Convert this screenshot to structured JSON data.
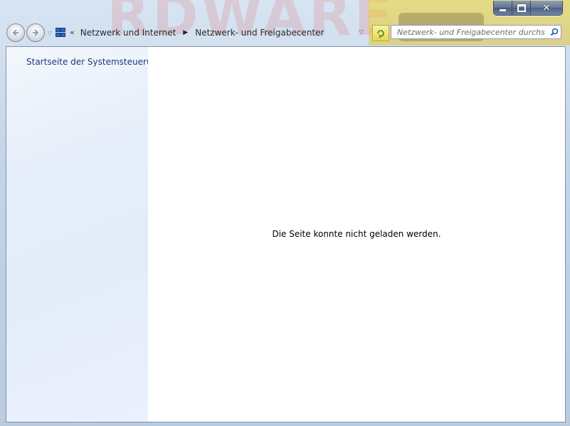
{
  "window": {
    "caption_buttons": {
      "minimize_icon": "minimize-icon",
      "maximize_icon": "maximize-icon",
      "close_glyph": "✕"
    }
  },
  "navigation": {
    "back_icon": "back-arrow-icon",
    "forward_icon": "forward-arrow-icon"
  },
  "address_bar": {
    "overflow_marker": "«",
    "breadcrumbs": [
      "Netzwerk und Internet",
      "Netzwerk- und Freigabecenter"
    ],
    "separator_icon": "chevron-right-icon"
  },
  "search": {
    "placeholder": "Netzwerk- und Freigabecenter durchs..."
  },
  "sidebar": {
    "home_link": "Startseite der Systemsteuerung"
  },
  "main": {
    "message": "Die Seite konnte nicht geladen werden."
  },
  "colors": {
    "sidebar_link": "#1c3b78",
    "client_background": "#ffffff",
    "sidebar_background": "#e6eefa"
  }
}
